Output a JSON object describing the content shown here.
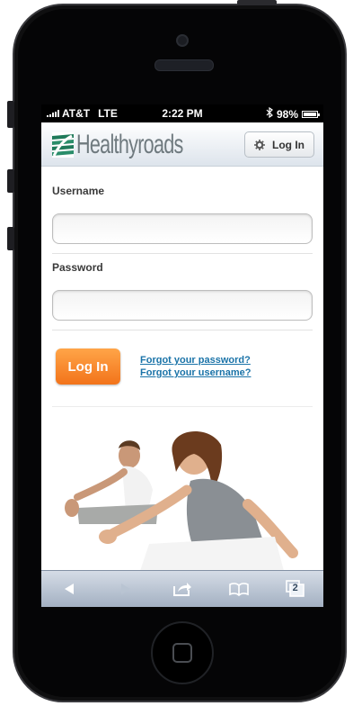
{
  "status_bar": {
    "carrier": "AT&T",
    "network": "LTE",
    "time": "2:22 PM",
    "battery": "98%",
    "bluetooth_icon": "bluetooth-icon"
  },
  "header": {
    "brand": "Healthyroads",
    "login_button": "Log In",
    "login_icon": "gear-icon"
  },
  "form": {
    "username_label": "Username",
    "username_value": "",
    "password_label": "Password",
    "password_value": "",
    "submit_label": "Log In",
    "forgot_password": "Forgot your password?",
    "forgot_username": "Forgot your username?"
  },
  "browser_toolbar": {
    "items": [
      "back-icon",
      "forward-icon",
      "share-icon",
      "bookmarks-icon",
      "tabs-icon"
    ],
    "tabs_count": "2"
  },
  "colors": {
    "accent_orange": "#f2731a",
    "link_blue": "#1a73a8",
    "brand_green": "#1f7a5a"
  }
}
